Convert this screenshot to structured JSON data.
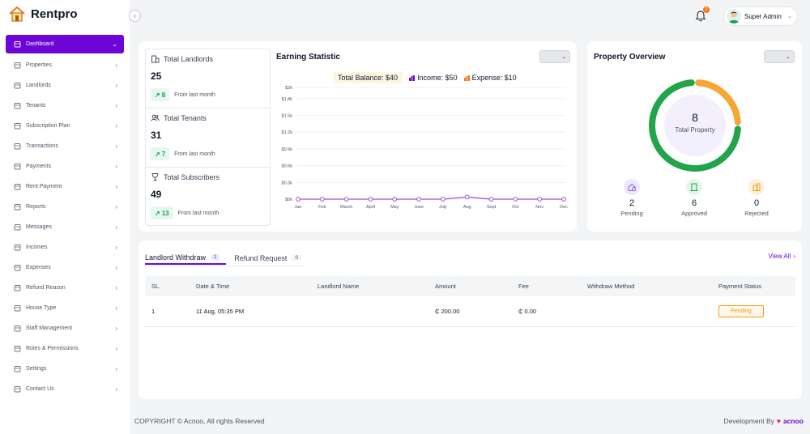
{
  "brand": {
    "name": "Rentpro"
  },
  "sidebar": {
    "items": [
      {
        "label": "Dashboard",
        "icon": "home-icon",
        "active": true
      },
      {
        "label": "Properties",
        "icon": "building-icon"
      },
      {
        "label": "Landlords",
        "icon": "landlord-icon"
      },
      {
        "label": "Tenants",
        "icon": "users-icon"
      },
      {
        "label": "Subscription Plan",
        "icon": "plan-icon"
      },
      {
        "label": "Transactions",
        "icon": "transactions-icon"
      },
      {
        "label": "Payments",
        "icon": "payments-icon"
      },
      {
        "label": "Rent Payment",
        "icon": "rent-payment-icon"
      },
      {
        "label": "Reports",
        "icon": "reports-icon"
      },
      {
        "label": "Messages",
        "icon": "message-icon"
      },
      {
        "label": "Incomes",
        "icon": "income-icon"
      },
      {
        "label": "Expenses",
        "icon": "expense-icon"
      },
      {
        "label": "Refund Reason",
        "icon": "refund-icon"
      },
      {
        "label": "House Type",
        "icon": "house-type-icon"
      },
      {
        "label": "Staff Management",
        "icon": "staff-icon"
      },
      {
        "label": "Roles & Permissions",
        "icon": "roles-icon"
      },
      {
        "label": "Settings",
        "icon": "settings-icon"
      },
      {
        "label": "Contact Us",
        "icon": "contact-icon"
      }
    ]
  },
  "header": {
    "notification_count": "2",
    "user_name": "Super Admin"
  },
  "stats": {
    "landlords": {
      "title": "Total Landlords",
      "value": "25",
      "change": "8",
      "note": "From last month"
    },
    "tenants": {
      "title": "Total Tenants",
      "value": "31",
      "change": "7",
      "note": "From last month"
    },
    "subscribers": {
      "title": "Total Subscribers",
      "value": "49",
      "change": "13",
      "note": "From last month"
    }
  },
  "earning": {
    "title": "Earning Statistic",
    "balance": "Total Balance: $40",
    "income": "Income: $50",
    "expense": "Expense: $10"
  },
  "chart_data": {
    "type": "line",
    "categories": [
      "Jan",
      "Feb",
      "March",
      "April",
      "May",
      "June",
      "July",
      "Aug",
      "Sept",
      "Oct",
      "Nov",
      "Dec"
    ],
    "y_ticks": [
      "$0k",
      "$0.3k",
      "$0.6k",
      "$0.9k",
      "$1.2k",
      "$1.5k",
      "$1.8k",
      "$2k"
    ],
    "y_tick_values": [
      0,
      300,
      600,
      900,
      1200,
      1500,
      1800,
      2000
    ],
    "ylim": [
      0,
      2000
    ],
    "series": [
      {
        "values": [
          0,
          0,
          0,
          0,
          0,
          0,
          0,
          40,
          0,
          0,
          0,
          0
        ]
      }
    ],
    "colors": {
      "line": "#9b4fd1",
      "income": "#6b06d6",
      "expense": "#f97316"
    }
  },
  "overview": {
    "title": "Property Overview",
    "total_value": "8",
    "total_label": "Total Property",
    "pending": {
      "value": "2",
      "label": "Pending",
      "color": "#8b5cf6"
    },
    "approved": {
      "value": "6",
      "label": "Approved",
      "color": "#16a34a"
    },
    "rejected": {
      "value": "0",
      "label": "Rejected",
      "color": "#f59e0b"
    },
    "donut": {
      "approved": 6,
      "pending": 2,
      "approved_color": "#22a44a",
      "pending_color": "#f8a532"
    }
  },
  "withdraw": {
    "tabs": [
      {
        "label": "Landlord Withdraw",
        "count": "2"
      },
      {
        "label": "Refund Request",
        "count": "0"
      }
    ],
    "view_all": "View All",
    "columns": [
      "SL.",
      "Date & Time",
      "Landlord Name",
      "Amount",
      "Fee",
      "Withdraw Method",
      "Payment Status"
    ],
    "rows": [
      {
        "sl": "1",
        "date": "11 Aug, 05:35 PM",
        "name": "",
        "amount": "₵ 200.00",
        "fee": "₵ 0.00",
        "method": "",
        "status": "Pending"
      }
    ]
  },
  "footer": {
    "copyright": "COPYRIGHT © Acnoo, All rights Reserved",
    "dev_by": "Development By",
    "dev_brand": "acnoo"
  },
  "theme": {
    "accent": "#6b06d6",
    "success": "#16a34a",
    "warning": "#f59e0b"
  }
}
